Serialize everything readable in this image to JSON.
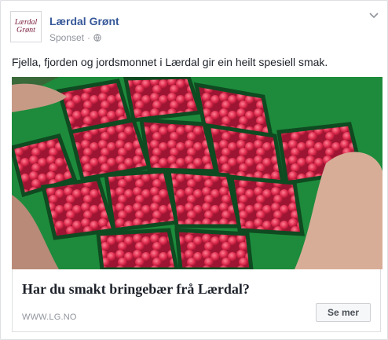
{
  "post": {
    "page_name": "Lærdal Grønt",
    "sponsored_label": "Sponset",
    "separator": "·",
    "text": "Fjella, fjorden og jordsmonnet i Lærdal gir ein heilt spesiell smak."
  },
  "avatar": {
    "line1": "Lærdal",
    "line2": "Grønt"
  },
  "link": {
    "headline": "Har du smakt bringebær frå Lærdal?",
    "domain": "WWW.LG.NO",
    "cta_label": "Se mer"
  },
  "colors": {
    "link_blue": "#365899",
    "crate_green": "#1f8a3a",
    "berry_red": "#d8234a"
  }
}
